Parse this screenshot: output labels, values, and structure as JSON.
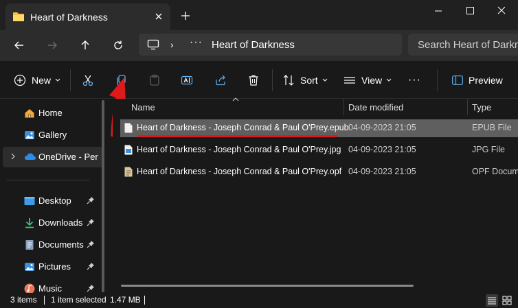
{
  "window": {
    "tab_title": "Heart of Darkness"
  },
  "nav": {
    "address_text": "Heart of Darkness",
    "address_sep": "›",
    "address_more": "···",
    "search_placeholder": "Search Heart of Darkness"
  },
  "toolbar": {
    "new_label": "New",
    "sort_label": "Sort",
    "view_label": "View",
    "more_label": "···",
    "preview_label": "Preview"
  },
  "sidebar": {
    "items": [
      {
        "label": "Home",
        "icon": "home-icon"
      },
      {
        "label": "Gallery",
        "icon": "gallery-icon"
      },
      {
        "label": "OneDrive - Per",
        "icon": "onedrive-icon"
      },
      {
        "label": "Desktop",
        "icon": "desktop-icon"
      },
      {
        "label": "Downloads",
        "icon": "downloads-icon"
      },
      {
        "label": "Documents",
        "icon": "documents-icon"
      },
      {
        "label": "Pictures",
        "icon": "pictures-icon"
      },
      {
        "label": "Music",
        "icon": "music-icon"
      }
    ]
  },
  "columns": {
    "name": "Name",
    "date": "Date modified",
    "type": "Type"
  },
  "files": [
    {
      "name": "Heart of Darkness - Joseph Conrad & Paul O'Prey.epub",
      "date": "04-09-2023 21:05",
      "type": "EPUB File"
    },
    {
      "name": "Heart of Darkness - Joseph Conrad & Paul O'Prey.jpg",
      "date": "04-09-2023 21:05",
      "type": "JPG File"
    },
    {
      "name": "Heart of Darkness - Joseph Conrad & Paul O'Prey.opf",
      "date": "04-09-2023 21:05",
      "type": "OPF Document"
    }
  ],
  "status": {
    "item_count": "3 items",
    "selected": "1 item selected",
    "size": "1.47 MB"
  },
  "colors": {
    "accent": "#0078d4",
    "annotation": "#e01a1a",
    "background": "#191919"
  }
}
